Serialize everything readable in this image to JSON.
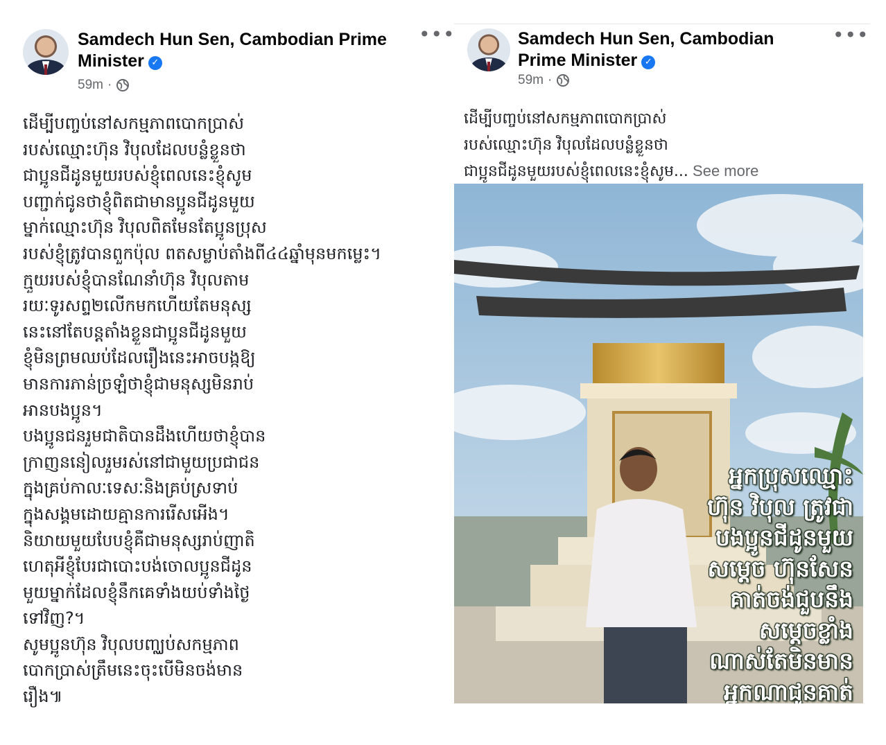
{
  "left_post": {
    "author": "Samdech Hun Sen, Cambodian Prime Minister",
    "time": "59m",
    "separator": "·",
    "more_label": "•••",
    "body_lines": [
      "ដើម្បីបញ្ចប់នៅសកម្មភាពបោកប្រាស់",
      "របស់ឈ្មោះហ៊ុន វិបុលដែលបន្លំខ្លួនថា",
      "ជាប្អូនជីដូនមួយរបស់ខ្ញុំពេលនេះខ្ញុំសូម",
      "បញ្ជាក់ជូនថាខ្ញុំពិតជាមានប្អូនជីដូនមួយ",
      "ម្នាក់ឈ្មោះហ៊ុន វិបុលពិតមែនតែប្អូនប្រុស",
      "របស់ខ្ញុំត្រូវបានពួកប៉ុល ពតសម្លាប់តាំងពី៤៤ឆ្នាំមុនមកម្លេះ។",
      "ក្មួយរបស់ខ្ញុំបានណែនាំហ៊ុន វិបុលតាម",
      "រយៈទូរសព្ទ២លើកមកហើយតែមនុស្ស",
      "នេះនៅតែបន្តតាំងខ្លួនជាប្អូនជីដូនមួយ",
      "ខ្ញុំមិនព្រមឈប់ដែលរឿងនេះអាចបង្កឱ្យ",
      "មានការភាន់ច្រឡំថាខ្ញុំជាមនុស្សមិនរាប់",
      "អានបងប្អូន។",
      "បងប្អូនជនរួមជាតិបានដឹងហើយថាខ្ញុំបាន",
      "ក្រាញននៀលរួមរស់នៅជាមួយប្រជាជន",
      "ក្នុងគ្រប់កាលៈទេសៈនិងគ្រប់ស្រទាប់",
      "ក្នុងសង្គមដោយគ្មានការរើសអើង។",
      "និយាយមួយបែបខ្ញុំគឺជាមនុស្សរាប់ញាតិ",
      "ហេតុអីខ្ញុំបែរជាបោះបង់ចោលប្អូនជីដូន",
      "មួយម្នាក់ដែលខ្ញុំនឹកគេទាំងយប់ទាំងថ្ងៃ",
      "ទៅវិញ?។",
      "សូមប្អូនហ៊ុន វិបុលបញ្ឈប់សកម្មភាព",
      "បោកប្រាស់ត្រឹមនេះចុះបើមិនចង់មាន",
      "រឿង៕"
    ]
  },
  "right_post": {
    "author": "Samdech Hun Sen, Cambodian Prime Minister",
    "time": "59m",
    "separator": "·",
    "more_label": "•••",
    "body_lines": [
      "ដើម្បីបញ្ចប់នៅសកម្មភាពបោកប្រាស់",
      "របស់ឈ្មោះហ៊ុន វិបុលដែលបន្លំខ្លួនថា",
      "ជាប្អូនជីដូនមួយរបស់ខ្ញុំពេលនេះខ្ញុំសូម..."
    ],
    "see_more": " See more",
    "photo": {
      "overlay_lines": [
        "អ្នកប្រុសឈ្មោះ",
        "ហ៊ុន វិបុល ត្រូវជា",
        "បងប្អូនជីដូនមួយ",
        "សម្តេច ហ៊ុនសែន",
        "គាត់ចង់ជួបនឹង",
        "សម្តេចខ្លាំង",
        "ណាស់តែមិនមាន",
        "អ្នកណាជូនគាត់"
      ]
    }
  }
}
